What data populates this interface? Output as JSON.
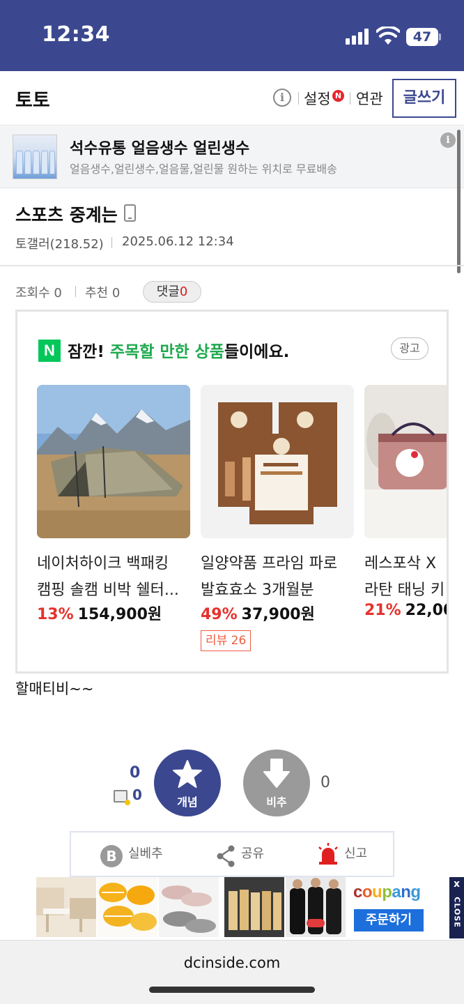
{
  "status_bar": {
    "time": "12:34",
    "battery": "47"
  },
  "header": {
    "gallery_title": "토토",
    "settings_label": "설정",
    "new_badge": "N",
    "related_label": "연관",
    "write_label": "글쓰기"
  },
  "top_ad": {
    "title": "석수유통 얼음생수 얼린생수",
    "description": "얼음생수,얼린생수,얼음물,얼린물 원하는 위치로 무료배송"
  },
  "post": {
    "title": "스포츠 중계는",
    "author": "토갤러(218.52)",
    "date": "2025.06.12 12:34",
    "views_label": "조회수 0",
    "recommend_label": "추천 0",
    "comment_label": "댓글",
    "comment_count": "0",
    "body": "할매티비~~"
  },
  "product_box": {
    "logo": "N",
    "headline_prefix": "잠깐! ",
    "headline_highlight": "주목할 만한 상품",
    "headline_suffix": "들이에요.",
    "ad_label": "광고",
    "products": [
      {
        "name_line1": "네이처하이크 백패킹",
        "name_line2": "캠핑 솔캠 비박 쉘터...",
        "discount": "13%",
        "price": "154,900원"
      },
      {
        "name_line1": "일양약품 프라임 파로",
        "name_line2": "발효효소 3개월분",
        "discount": "49%",
        "price": "37,900원",
        "review": "리뷰 26"
      },
      {
        "name_line1": "레스포삭 X",
        "name_line2": "라탄 태닝 키",
        "discount": "21%",
        "price": "22,00"
      }
    ]
  },
  "votes": {
    "concept_count": "0",
    "fixed_count": "0",
    "concept_label": "개념",
    "downvote_label": "비추",
    "downvote_count": "0"
  },
  "actions": {
    "best_label": "실베추",
    "share_label": "공유",
    "report_label": "신고",
    "best_icon_letter": "B"
  },
  "bottom_ad": {
    "brand": "coupang",
    "order_label": "주문하기",
    "close_label": "CLOSE",
    "close_x": "x"
  },
  "browser": {
    "url": "dcinside.com"
  },
  "colors": {
    "brand_navy": "#3b4890",
    "naver_green": "#03c75a",
    "discount_red": "#e5322d",
    "coupang_blue": "#1d6fdc"
  }
}
